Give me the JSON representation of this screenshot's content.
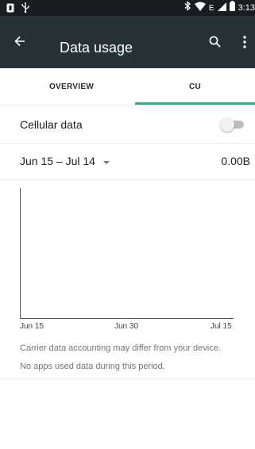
{
  "status_bar": {
    "time": "3:13",
    "network_label": "E",
    "icons": [
      "notification-icon",
      "usb-icon",
      "bluetooth-icon",
      "wifi-icon",
      "signal-icon",
      "battery-icon"
    ]
  },
  "app_bar": {
    "title": "Data usage",
    "background": "#263238",
    "icons": [
      "back-arrow-icon",
      "search-icon",
      "more-vert-icon"
    ]
  },
  "tabs": [
    {
      "label": "OVERVIEW",
      "selected": false
    },
    {
      "label": "CU",
      "selected": true
    }
  ],
  "accent_color": "#3aa699",
  "cellular": {
    "label": "Cellular data",
    "enabled": false
  },
  "cycle": {
    "range": "Jun 15 – Jul 14",
    "usage": "0.00B"
  },
  "chart": {
    "x_ticks": [
      "Jun 15",
      "Jun 30",
      "Jul 15"
    ]
  },
  "notes": {
    "line1": "Carrier data accounting may differ from your device.",
    "line2": "No apps used data during this period."
  }
}
